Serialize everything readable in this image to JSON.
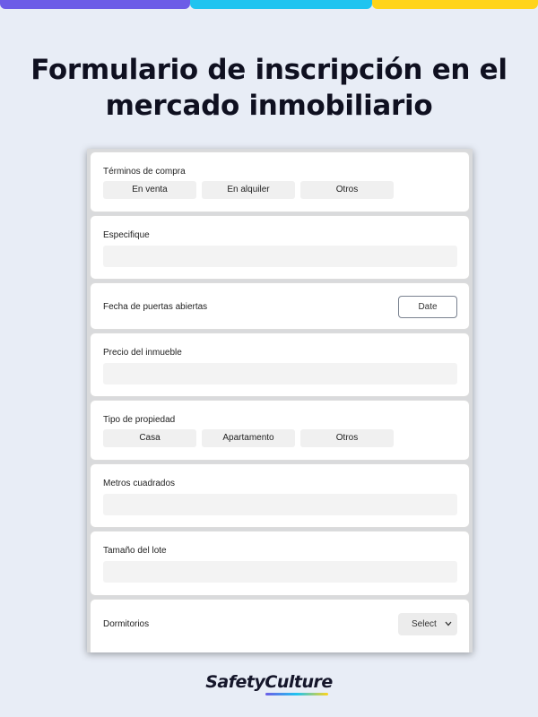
{
  "colors": {
    "purple": "#6c5ce7",
    "cyan": "#1fc4f0",
    "yellow": "#ffd41a",
    "background": "#e8edf6"
  },
  "heading": {
    "line1": "Formulario de inscripción en el",
    "line2": "mercado inmobiliario"
  },
  "form": {
    "purchase_terms": {
      "label": "Términos de compra",
      "options": [
        "En venta",
        "En alquiler",
        "Otros"
      ]
    },
    "specify": {
      "label": "Especifique",
      "value": ""
    },
    "open_house_date": {
      "label": "Fecha de puertas abiertas",
      "button": "Date"
    },
    "property_price": {
      "label": "Precio del inmueble",
      "value": ""
    },
    "property_type": {
      "label": "Tipo de propiedad",
      "options": [
        "Casa",
        "Apartamento",
        "Otros"
      ]
    },
    "square_meters": {
      "label": "Metros cuadrados",
      "value": ""
    },
    "lot_size": {
      "label": "Tamaño del lote",
      "value": ""
    },
    "bedrooms": {
      "label": "Dormitorios",
      "select": "Select",
      "icon": "chevron-down-icon"
    }
  },
  "brand": {
    "logo": "SafetyCulture"
  }
}
